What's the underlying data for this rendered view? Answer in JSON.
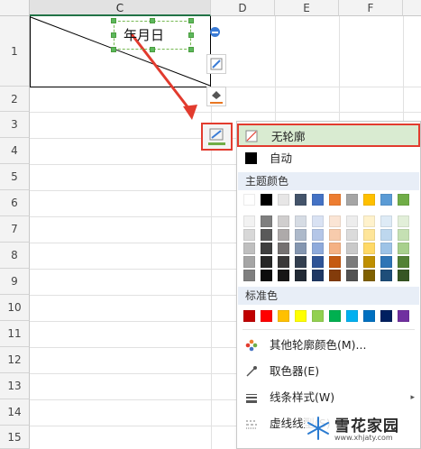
{
  "spreadsheet": {
    "columns": [
      "C",
      "D",
      "E",
      "F"
    ],
    "rows": [
      "1",
      "2",
      "3",
      "4",
      "5",
      "6",
      "7",
      "8",
      "9",
      "10",
      "11",
      "12",
      "13",
      "14",
      "15"
    ],
    "cell_text": "年月日"
  },
  "menu": {
    "no_outline": "无轮廓",
    "auto": "自动",
    "theme_colors_header": "主题颜色",
    "standard_colors_header": "标准色",
    "more_colors": "其他轮廓颜色(M)...",
    "eyedropper": "取色器(E)",
    "line_style": "线条样式(W)",
    "dash_style": "虚线线型(S)"
  },
  "theme_colors": [
    [
      "#ffffff",
      "#000000",
      "#e7e6e6",
      "#44546a",
      "#4472c4",
      "#ed7d31",
      "#a5a5a5",
      "#ffc000",
      "#5b9bd5",
      "#70ad47"
    ],
    [
      "#f2f2f2",
      "#7f7f7f",
      "#d0cece",
      "#d6dce4",
      "#d9e2f3",
      "#fbe5d5",
      "#ededed",
      "#fff2cc",
      "#deebf6",
      "#e2efd9"
    ],
    [
      "#d8d8d8",
      "#595959",
      "#aeaaaa",
      "#adb9ca",
      "#b4c6e7",
      "#f7cbac",
      "#dbdbdb",
      "#fee599",
      "#bdd7ee",
      "#c5e0b3"
    ],
    [
      "#bfbfbf",
      "#3f3f3f",
      "#757171",
      "#8496b0",
      "#8eaadb",
      "#f4b183",
      "#c9c9c9",
      "#ffd966",
      "#9dc3e6",
      "#a8d08d"
    ],
    [
      "#a5a5a5",
      "#262626",
      "#3a3838",
      "#333f4f",
      "#2f5496",
      "#c55a11",
      "#7b7b7b",
      "#bf8f00",
      "#2e75b5",
      "#538135"
    ],
    [
      "#7f7f7f",
      "#0c0c0c",
      "#171616",
      "#222a35",
      "#1f3864",
      "#833c0b",
      "#525252",
      "#7f6000",
      "#1e4e79",
      "#375623"
    ]
  ],
  "standard_colors": [
    "#c00000",
    "#ff0000",
    "#ffc000",
    "#ffff00",
    "#92d050",
    "#00b050",
    "#00b0f0",
    "#0070c0",
    "#002060",
    "#7030a0"
  ],
  "watermark": {
    "logo_text": "雪花家园",
    "url_text": "www.xhjaty.com"
  },
  "colors": {
    "accent_red": "#e23b2e",
    "highlight_green": "#d9ebd1",
    "selection_green": "#217346"
  }
}
